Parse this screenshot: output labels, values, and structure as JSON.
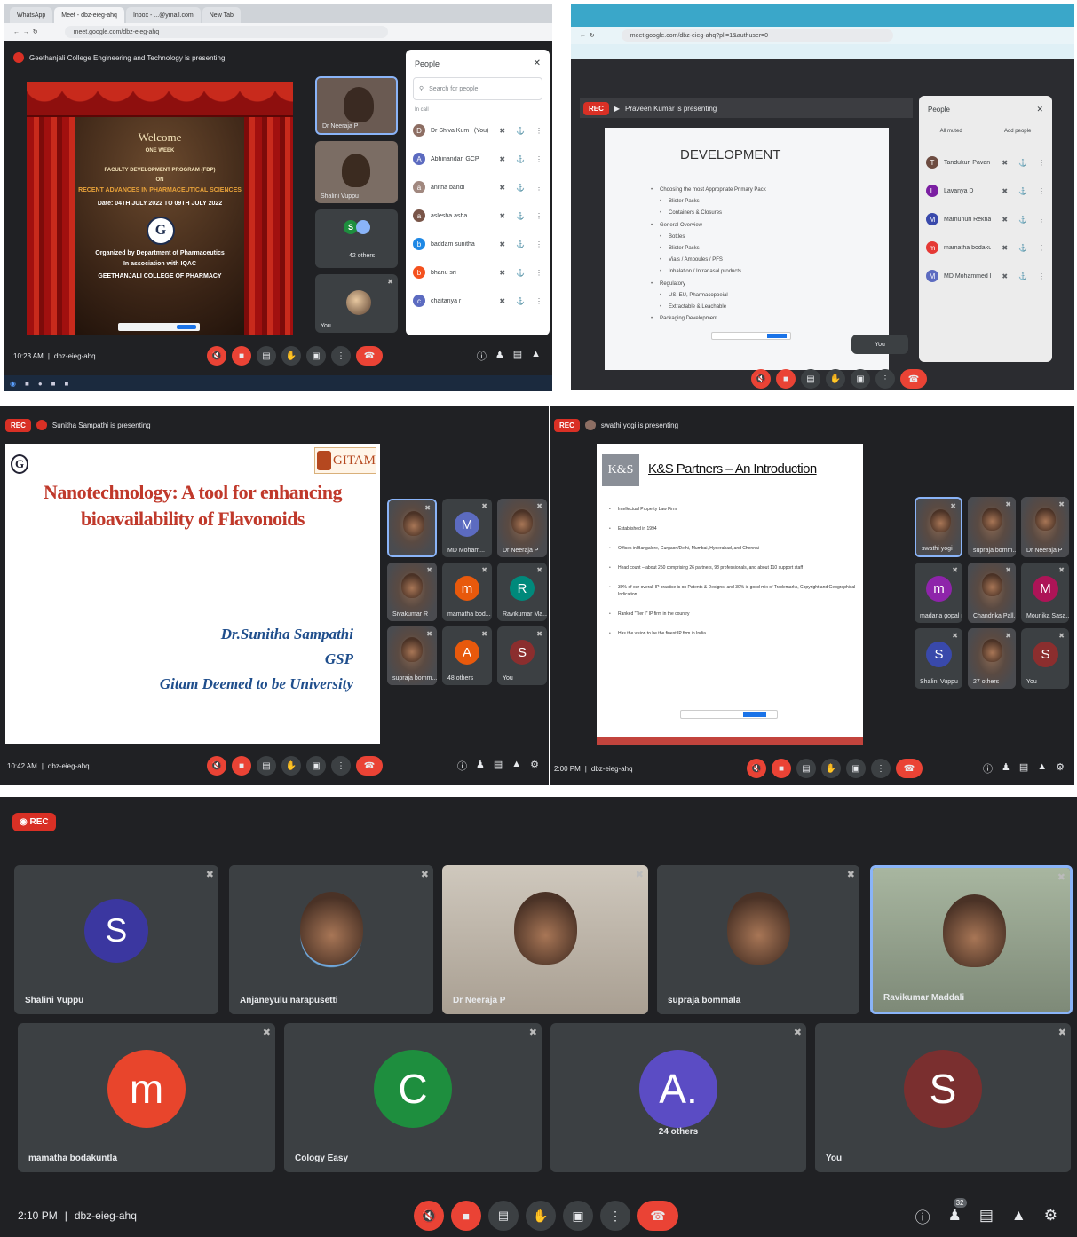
{
  "panel1": {
    "tabs": [
      "WhatsApp",
      "Meet - dbz-eieg-ahq",
      "Inbox - ...@ymail.com",
      "New Tab"
    ],
    "url": "meet.google.com/dbz-eieg-ahq",
    "presenting": "Geethanjali College Engineering and Technology is presenting",
    "banner": {
      "welcome": "Welcome",
      "one_week": "ONE WEEK",
      "program": "FACULTY DEVELOPMENT PROGRAM (FDP)",
      "on": "ON",
      "topic": "RECENT ADVANCES IN PHARMACEUTICAL SCIENCES",
      "date": "Date: 04TH JULY 2022 TO 09TH JULY 2022",
      "organized": "Organized by Department of Pharmaceutics",
      "assoc": "In association with IQAC",
      "college": "GEETHANJALI COLLEGE OF PHARMACY"
    },
    "tiles": [
      {
        "name": "Dr Neeraja P"
      },
      {
        "name": "Shalini Vuppu"
      },
      {
        "name": "42 others"
      },
      {
        "name": "You"
      }
    ],
    "people_panel": {
      "title": "People",
      "search_placeholder": "Search for people",
      "section": "In call",
      "members": [
        {
          "name": "Dr Shiva Kumar Ye...",
          "tag": "(You)",
          "initial": "D",
          "color": "#8d6e63"
        },
        {
          "name": "Abhinandan GCP",
          "initial": "A",
          "color": "#5c6bc0"
        },
        {
          "name": "anitha bandi",
          "initial": "a",
          "color": "#a1887f"
        },
        {
          "name": "aslesha asha",
          "initial": "a",
          "color": "#795548"
        },
        {
          "name": "baddam sunitha",
          "initial": "b",
          "color": "#1e88e5"
        },
        {
          "name": "bhanu sri",
          "initial": "b",
          "color": "#f4511e"
        },
        {
          "name": "chaitanya r",
          "initial": "c",
          "color": "#5c6bc0"
        }
      ]
    },
    "time": "10:23 AM",
    "code": "dbz-eieg-ahq"
  },
  "panel2": {
    "url": "meet.google.com/dbz-eieg-ahq?pli=1&authuser=0",
    "rec": "REC",
    "presenting": "Praveen Kumar is presenting",
    "slide": {
      "title": "DEVELOPMENT",
      "bullets": [
        "Choosing the most Appropriate Primary Pack",
        "Blister Packs",
        "Containers & Closures",
        "General Overview",
        "Bottles",
        "Blister Packs",
        "Vials / Ampoules / PFS",
        "Inhalation / Intranasal products",
        "Regulatory",
        "US, EU, Pharmacopoeial",
        "Extractable & Leachable",
        "Packaging Development"
      ]
    },
    "people_panel": {
      "title": "People",
      "tab_all": "All muted",
      "tab_add": "Add people",
      "members": [
        {
          "name": "Tandukuri Pavan",
          "initial": "T",
          "color": "#6d4c41"
        },
        {
          "name": "Lavanya D",
          "initial": "L",
          "color": "#7b1fa2"
        },
        {
          "name": "Mamunuri Rekha",
          "initial": "M",
          "color": "#3949ab"
        },
        {
          "name": "mamatha bodaku...",
          "initial": "m",
          "color": "#e53935"
        },
        {
          "name": "MD Mohammed Fa...",
          "initial": "M",
          "color": "#5c6bc0"
        }
      ]
    }
  },
  "panel3": {
    "rec": "REC",
    "presenting": "Sunitha Sampathi is presenting",
    "slide": {
      "title_line1": "Nanotechnology: A tool for enhancing",
      "title_line2": "bioavailability of Flavonoids",
      "logo_text": "GITAM",
      "author": "Dr.Sunitha Sampathi",
      "dept": "GSP",
      "univ": "Gitam Deemed to be University"
    },
    "tiles": [
      {
        "name": "",
        "initial": ""
      },
      {
        "name": "MD Moham...",
        "initial": "M",
        "color": "#5c6bc0"
      },
      {
        "name": "Dr Neeraja P",
        "initial": ""
      },
      {
        "name": "Sivakumar R",
        "initial": ""
      },
      {
        "name": "mamatha bod...",
        "initial": "m",
        "color": "#e8590c"
      },
      {
        "name": "Ravikumar Ma...",
        "initial": "R",
        "color": "#00897b"
      },
      {
        "name": "supraja bomm...",
        "initial": ""
      },
      {
        "name": "48 others",
        "initial": "A",
        "color": "#e8590c"
      },
      {
        "name": "You",
        "initial": "S",
        "color": "#8b2e2e"
      }
    ],
    "time": "10:42 AM",
    "code": "dbz-eieg-ahq"
  },
  "panel4": {
    "rec": "REC",
    "presenting": "swathi yogi is presenting",
    "slide": {
      "logo": "K&S",
      "title": "K&S Partners – An Introduction",
      "bullets": [
        "Intellectual Property Law Firm",
        "Established in 1994",
        "Offices in Bangalore, Gurgaon/Delhi, Mumbai, Hyderabad, and Chennai",
        "Head count – about 250 comprising 26 partners, 98 professionals, and about 110 support staff",
        "30% of our overall IP practice is on Patents & Designs, and 30% is good mix of Trademarks, Copyright and Geographical Indication",
        "Ranked \"Tier I\" IP firm in the country",
        "Has the vision to be the finest IP firm in India"
      ]
    },
    "tiles": [
      {
        "name": "swathi yogi",
        "initial": ""
      },
      {
        "name": "supraja bomm...",
        "initial": ""
      },
      {
        "name": "Dr Neeraja P",
        "initial": ""
      },
      {
        "name": "madana gopal n",
        "initial": "m",
        "color": "#8e24aa"
      },
      {
        "name": "Chandrika Pall...",
        "initial": ""
      },
      {
        "name": "Mounika Sasa...",
        "initial": "M",
        "color": "#ad1457"
      },
      {
        "name": "Shalini Vuppu",
        "initial": "S",
        "color": "#3949ab"
      },
      {
        "name": "27 others",
        "initial": ""
      },
      {
        "name": "You",
        "initial": "S",
        "color": "#8b2e2e"
      }
    ],
    "time": "2:00 PM",
    "code": "dbz-eieg-ahq"
  },
  "panel5": {
    "rec": "REC",
    "tiles": [
      {
        "name": "Shalini Vuppu",
        "initial": "S",
        "color": "#3b37a0"
      },
      {
        "name": "Anjaneyulu narapusetti",
        "initial": ""
      },
      {
        "name": "Dr Neeraja P",
        "initial": ""
      },
      {
        "name": "supraja bommala",
        "initial": ""
      },
      {
        "name": "Ravikumar Maddali",
        "initial": ""
      },
      {
        "name": "mamatha bodakuntla",
        "initial": "m",
        "color": "#e8452c"
      },
      {
        "name": "Cology Easy",
        "initial": "C",
        "color": "#1e8e3e"
      },
      {
        "name": "24 others",
        "initial": "A.",
        "color": "#5b4cc4"
      },
      {
        "name": "You",
        "initial": "S",
        "color": "#7a2f2f"
      }
    ],
    "participant_count": "32",
    "time": "2:10 PM",
    "code": "dbz-eieg-ahq"
  }
}
